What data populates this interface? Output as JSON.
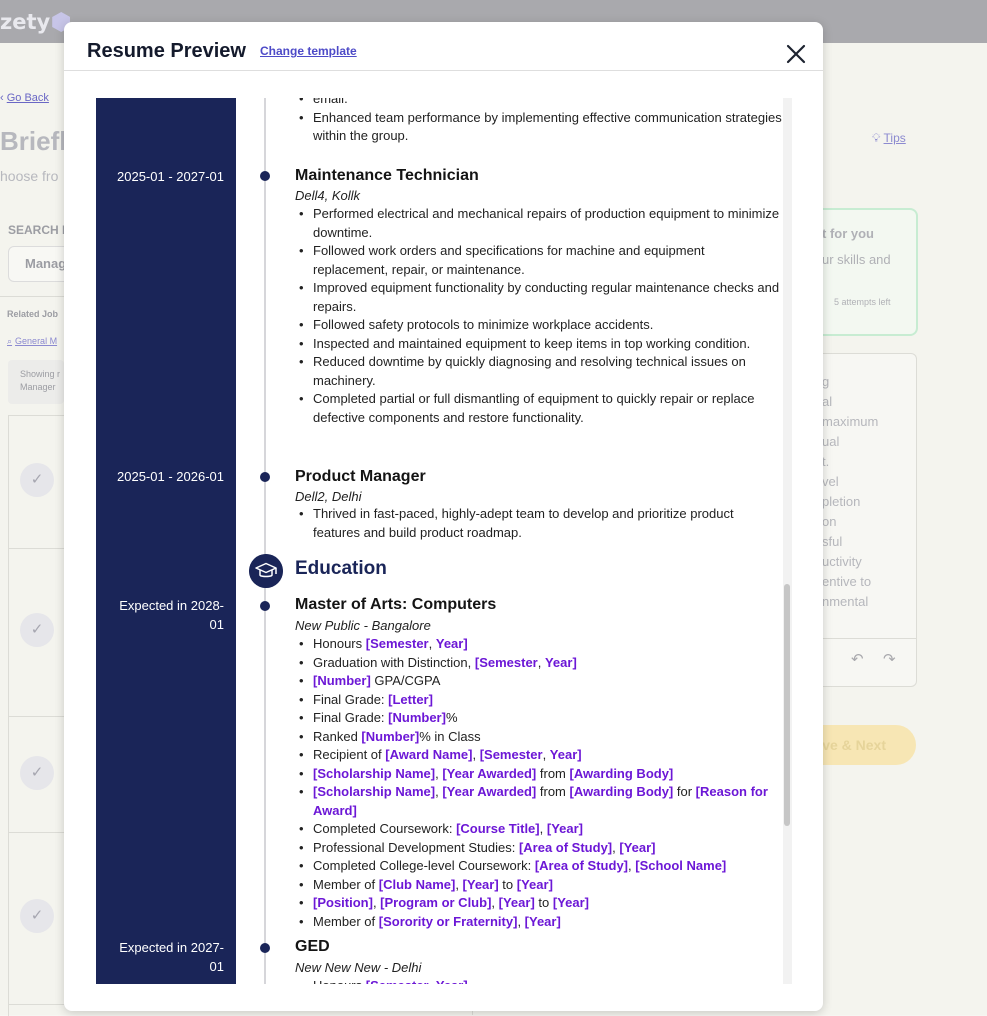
{
  "background": {
    "logo_text": "zety",
    "go_back": "Go Back",
    "page_title": "Briefly",
    "page_subtitle": "hoose fro",
    "search_label": "SEARCH B",
    "search_value": "Manag",
    "related": "Related Job",
    "general_link": "General M",
    "showing_line1": "Showing r",
    "showing_line2": "Manager",
    "tips": "Tips",
    "ai_title": "t for you",
    "ai_sub": "ur skills and",
    "ai_attempts": "5 attempts left",
    "editor_lines": [
      "g",
      "al",
      "maximum",
      "ual",
      "t.",
      "vel",
      "pletion",
      "on",
      "sful",
      "uctivity",
      "entive to",
      "nmental"
    ],
    "save_next": "ve & Next"
  },
  "modal": {
    "title": "Resume Preview",
    "change_template": "Change template"
  },
  "resume": {
    "top_bullets": [
      "email.",
      "Enhanced team performance by implementing effective communication strategies within the group."
    ],
    "jobs": [
      {
        "date": "2025-01 - 2027-01",
        "title": "Maintenance Technician",
        "company": "Dell4, Kollk",
        "bullets": [
          "Performed electrical and mechanical repairs of production equipment to minimize downtime.",
          "Followed work orders and specifications for machine and equipment replacement, repair, or maintenance.",
          "Improved equipment functionality by conducting regular maintenance checks and repairs.",
          "Followed safety protocols to minimize workplace accidents.",
          "Inspected and maintained equipment to keep items in top working condition.",
          "Reduced downtime by quickly diagnosing and resolving technical issues on machinery.",
          "Completed partial or full dismantling of equipment to quickly repair or replace defective components and restore functionality."
        ]
      },
      {
        "date": "2025-01 - 2026-01",
        "title": "Product Manager",
        "company": "Dell2, Delhi",
        "bullets": [
          "Thrived in fast-paced, highly-adept team to develop and prioritize product features and build product roadmap."
        ]
      }
    ],
    "education_heading": "Education",
    "education": [
      {
        "date_line1": "Expected in 2028-",
        "date_line2": "01",
        "degree": "Master of Arts: Computers",
        "school": "New Public - Bangalore",
        "bullets": [
          {
            "a": "Honours ",
            "b": "[Semester",
            "c": ", ",
            "d": "Year]",
            "e": "",
            "f": "",
            "g": "",
            "h": ""
          },
          {
            "a": "Graduation with Distinction, ",
            "b": "[Semester",
            "c": ", ",
            "d": "Year]",
            "e": "",
            "f": "",
            "g": "",
            "h": ""
          },
          {
            "a": "",
            "b": "[Number]",
            "c": " GPA/CGPA",
            "d": "",
            "e": "",
            "f": "",
            "g": "",
            "h": ""
          },
          {
            "a": "Final Grade: ",
            "b": "[Letter]",
            "c": "",
            "d": "",
            "e": "",
            "f": "",
            "g": "",
            "h": ""
          },
          {
            "a": "Final Grade: ",
            "b": "[Number]",
            "c": "%",
            "d": "",
            "e": "",
            "f": "",
            "g": "",
            "h": ""
          },
          {
            "a": "Ranked ",
            "b": "[Number]",
            "c": "% in Class",
            "d": "",
            "e": "",
            "f": "",
            "g": "",
            "h": ""
          },
          {
            "a": "Recipient of ",
            "b": "[Award Name]",
            "c": ", ",
            "d": "[Semester",
            "e": ", ",
            "f": "Year]",
            "g": "",
            "h": ""
          },
          {
            "a": "",
            "b": "[Scholarship Name]",
            "c": ", ",
            "d": "[Year Awarded]",
            "e": " from ",
            "f": "[Awarding Body]",
            "g": "",
            "h": ""
          },
          {
            "a": "",
            "b": "[Scholarship Name]",
            "c": ", ",
            "d": "[Year Awarded]",
            "e": " from ",
            "f": "[Awarding Body]",
            "g": " for ",
            "h": "[Reason for Award]"
          },
          {
            "a": "Completed Coursework: ",
            "b": "[Course Title]",
            "c": ", ",
            "d": "[Year]",
            "e": "",
            "f": "",
            "g": "",
            "h": ""
          },
          {
            "a": "Professional Development Studies: ",
            "b": "[Area of Study]",
            "c": ", ",
            "d": "[Year]",
            "e": "",
            "f": "",
            "g": "",
            "h": ""
          },
          {
            "a": "Completed College-level Coursework: ",
            "b": "[Area of Study]",
            "c": ", ",
            "d": "[School Name]",
            "e": "",
            "f": "",
            "g": "",
            "h": ""
          },
          {
            "a": "Member of ",
            "b": "[Club Name]",
            "c": ", ",
            "d": "[Year]",
            "e": " to ",
            "f": "[Year]",
            "g": "",
            "h": ""
          },
          {
            "a": "",
            "b": "[Position]",
            "c": ", ",
            "d": "[Program or Club]",
            "e": ", ",
            "f": "[Year]",
            "g": " to ",
            "h": "[Year]"
          },
          {
            "a": "Member of ",
            "b": "[Sorority or Fraternity]",
            "c": ", ",
            "d": "[Year]",
            "e": "",
            "f": "",
            "g": "",
            "h": ""
          }
        ]
      },
      {
        "date_line1": "Expected in 2027-",
        "date_line2": "01",
        "degree": "GED",
        "school": "New New New - Delhi",
        "bullets": [
          {
            "a": "Honours ",
            "b": "[Semester",
            "c": ", ",
            "d": "Year]",
            "e": "",
            "f": "",
            "g": "",
            "h": ""
          }
        ]
      }
    ]
  }
}
